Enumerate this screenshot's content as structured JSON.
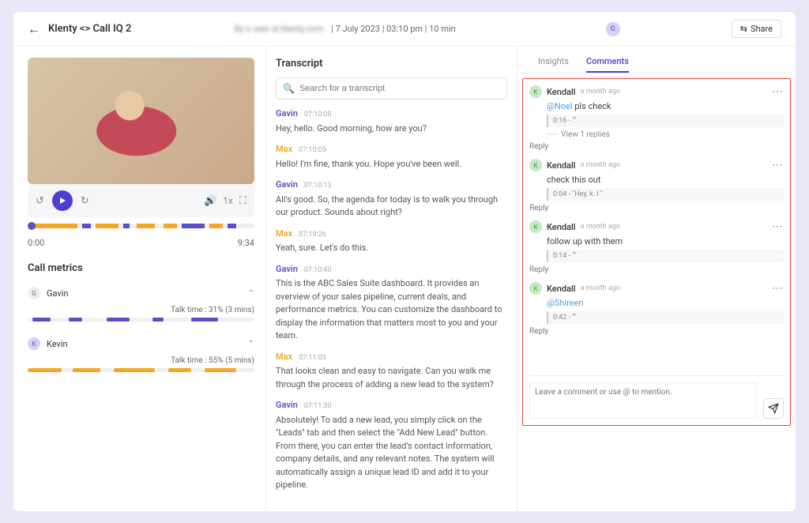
{
  "header": {
    "title": "Klenty <> Call IQ 2",
    "sub_blurred": "By a user at klenty.com",
    "date": "7 July 2023",
    "time": "03:10 pm",
    "duration": "10 min",
    "avatar": "G",
    "share_label": "Share"
  },
  "video": {
    "current_time": "0:00",
    "total_time": "9:34",
    "speed": "1x"
  },
  "call_metrics": {
    "title": "Call metrics",
    "speakers": [
      {
        "initial": "G",
        "name": "Gavin",
        "talk_time": "Talk time : 31% (3 mins)",
        "class": "av-g"
      },
      {
        "initial": "K",
        "name": "Kevin",
        "talk_time": "Talk time : 55% (5 mins)",
        "class": "av-k"
      }
    ]
  },
  "transcript": {
    "title": "Transcript",
    "search_placeholder": "Search for a transcript",
    "lines": [
      {
        "speaker": "Gavin",
        "cls": "sp-g",
        "ts": "07:10:00",
        "text": "Hey, hello. Good morning, how are you?"
      },
      {
        "speaker": "Max",
        "cls": "sp-m",
        "ts": "07:10:05",
        "text": "Hello! I'm fine, thank you. Hope you've been well."
      },
      {
        "speaker": "Gavin",
        "cls": "sp-g",
        "ts": "07:10:13",
        "text": "All's good. So, the agenda for today is to walk you through our product. Sounds about right?"
      },
      {
        "speaker": "Max",
        "cls": "sp-m",
        "ts": "07:10:26",
        "text": "Yeah, sure. Let's do this."
      },
      {
        "speaker": "Gavin",
        "cls": "sp-g",
        "ts": "07:10:40",
        "text": "This is the ABC Sales Suite dashboard. It provides an overview of your sales pipeline, current deals, and performance metrics. You can customize the dashboard to display the information that matters most to you and your team."
      },
      {
        "speaker": "Max",
        "cls": "sp-m",
        "ts": "07:11:03",
        "text": "That looks clean and easy to navigate. Can you walk me through the process of adding a new lead to the system?"
      },
      {
        "speaker": "Gavin",
        "cls": "sp-g",
        "ts": "07:11:30",
        "text": "Absolutely! To add a new lead, you simply click on the \"Leads\" tab and then select the \"Add New Lead\" button. From there, you can enter the lead's contact information, company details, and any relevant notes. The system will automatically assign a unique lead ID and add it to your pipeline."
      }
    ]
  },
  "tabs": {
    "insights": "Insights",
    "comments": "Comments"
  },
  "comments": {
    "input_placeholder": "Leave a comment or use @ to mention.",
    "view_replies": "View 1 replies",
    "reply_label": "Reply",
    "list": [
      {
        "author": "Kendall",
        "time": "a month ago",
        "mention": "@Noel",
        "body": " pls check",
        "quote": "0:16 - \"\"",
        "show_replies": true
      },
      {
        "author": "Kendall",
        "time": "a month ago",
        "body": "check this out",
        "quote": "0:04 - \"Hey, k. I \""
      },
      {
        "author": "Kendall",
        "time": "a month ago",
        "body": "follow up with them",
        "quote": "0:14 - \"\""
      },
      {
        "author": "Kendall",
        "time": "a month ago",
        "mention": "@Shireen",
        "body": "",
        "quote": "0:42 - \"\""
      }
    ]
  }
}
